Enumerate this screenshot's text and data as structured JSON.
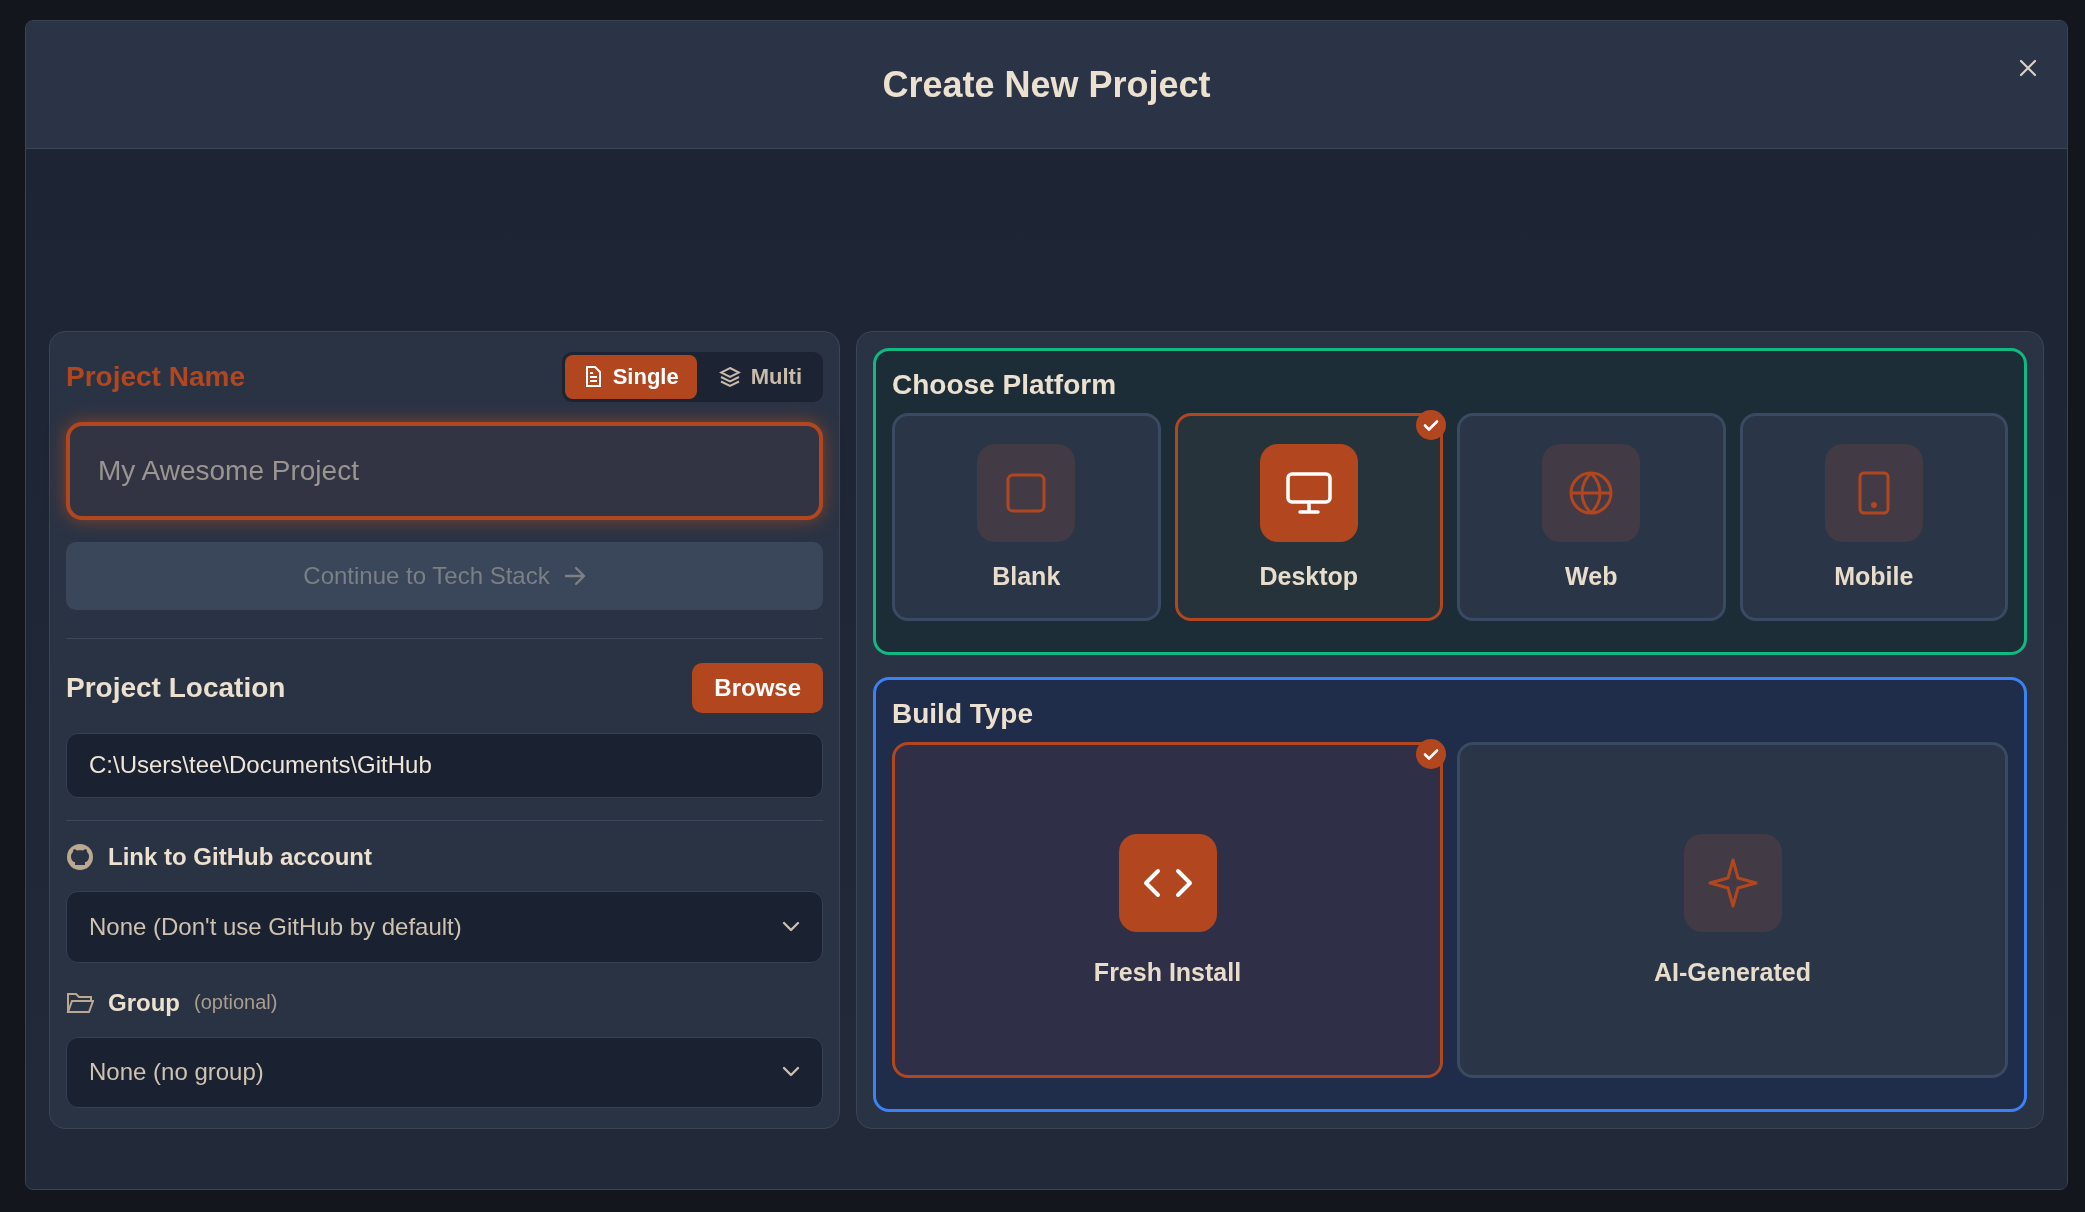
{
  "dialog": {
    "title": "Create New Project"
  },
  "project_name": {
    "label": "Project Name",
    "modes": [
      {
        "kind": "single",
        "label": "Single",
        "selected": true
      },
      {
        "kind": "multi",
        "label": "Multi",
        "selected": false
      }
    ],
    "placeholder": "My Awesome Project",
    "continue": {
      "label": "Continue to Tech Stack",
      "disabled": true
    }
  },
  "location": {
    "label": "Project Location",
    "browse": "Browse",
    "value": "C:\\Users\\tee\\Documents\\GitHub"
  },
  "github": {
    "label": "Link to GitHub account",
    "value": "None (Don't use GitHub by default)"
  },
  "group": {
    "label": "Group",
    "hint": "(optional)",
    "value": "None (no group)"
  },
  "platform": {
    "title": "Choose Platform",
    "options": [
      {
        "kind": "blank",
        "label": "Blank",
        "selected": false
      },
      {
        "kind": "desktop",
        "label": "Desktop",
        "selected": true
      },
      {
        "kind": "web",
        "label": "Web",
        "selected": false
      },
      {
        "kind": "mobile",
        "label": "Mobile",
        "selected": false
      }
    ]
  },
  "build_type": {
    "title": "Build Type",
    "options": [
      {
        "kind": "fresh",
        "label": "Fresh Install",
        "selected": true
      },
      {
        "kind": "ai",
        "label": "AI-Generated",
        "selected": false
      }
    ]
  }
}
